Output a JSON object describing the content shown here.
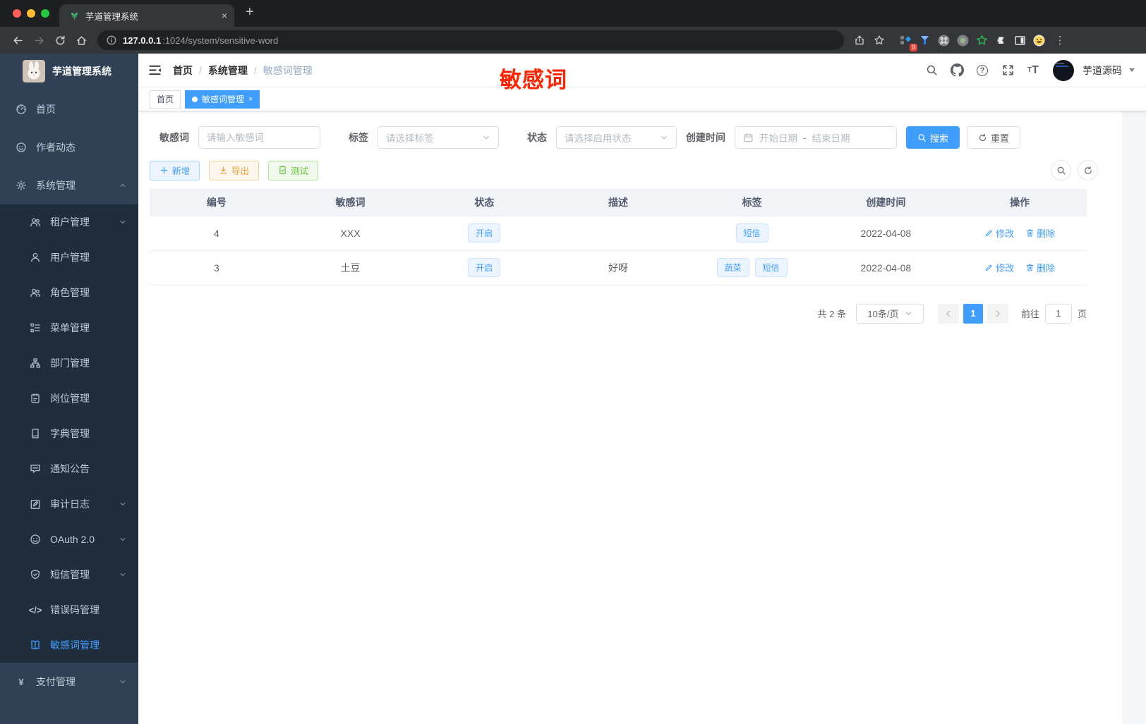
{
  "browser": {
    "tab_title": "芋道管理系统",
    "url_host": "127.0.0.1",
    "url_path": ":1024/system/sensitive-word",
    "extension_badge": "9"
  },
  "sidebar": {
    "title": "芋道管理系统",
    "items": [
      {
        "label": "首页",
        "icon": "dashboard-icon",
        "level": 1
      },
      {
        "label": "作者动态",
        "icon": "author-icon",
        "level": 1
      },
      {
        "label": "系统管理",
        "icon": "gear-icon",
        "level": 1,
        "chevron": "up"
      },
      {
        "label": "租户管理",
        "icon": "tenant-icon",
        "level": 2,
        "chevron": "down"
      },
      {
        "label": "用户管理",
        "icon": "user-icon",
        "level": 2
      },
      {
        "label": "角色管理",
        "icon": "role-icon",
        "level": 2
      },
      {
        "label": "菜单管理",
        "icon": "menu-tree-icon",
        "level": 2
      },
      {
        "label": "部门管理",
        "icon": "dept-icon",
        "level": 2
      },
      {
        "label": "岗位管理",
        "icon": "post-icon",
        "level": 2
      },
      {
        "label": "字典管理",
        "icon": "dict-icon",
        "level": 2
      },
      {
        "label": "通知公告",
        "icon": "notice-icon",
        "level": 2
      },
      {
        "label": "审计日志",
        "icon": "audit-icon",
        "level": 2,
        "chevron": "down"
      },
      {
        "label": "OAuth 2.0",
        "icon": "oauth-icon",
        "level": 2,
        "chevron": "down"
      },
      {
        "label": "短信管理",
        "icon": "sms-icon",
        "level": 2,
        "chevron": "down"
      },
      {
        "label": "错误码管理",
        "icon": "errorcode-icon",
        "level": 2
      },
      {
        "label": "敏感词管理",
        "icon": "sensitive-word-icon",
        "level": 2,
        "active": true
      },
      {
        "label": "支付管理",
        "icon": "pay-icon",
        "level": 1,
        "chevron": "down"
      }
    ]
  },
  "header": {
    "breadcrumb": [
      "首页",
      "系统管理",
      "敏感词管理"
    ],
    "user_name": "芋道源码"
  },
  "tags_view": {
    "tabs": [
      {
        "label": "首页",
        "active": false,
        "closable": false
      },
      {
        "label": "敏感词管理",
        "active": true,
        "closable": true
      }
    ]
  },
  "annotation": {
    "text": "敏感词",
    "color": "#ff2400"
  },
  "filters": {
    "word": {
      "label": "敏感词",
      "placeholder": "请输入敏感词"
    },
    "tag": {
      "label": "标签",
      "placeholder": "请选择标签"
    },
    "status": {
      "label": "状态",
      "placeholder": "请选择启用状态"
    },
    "create_time": {
      "label": "创建时间",
      "start_placeholder": "开始日期",
      "separator": "-",
      "end_placeholder": "结束日期"
    },
    "search_label": "搜索",
    "reset_label": "重置"
  },
  "toolbar": {
    "add_label": "新增",
    "export_label": "导出",
    "test_label": "测试"
  },
  "table": {
    "columns": [
      "编号",
      "敏感词",
      "状态",
      "描述",
      "标签",
      "创建时间",
      "操作"
    ],
    "rows": [
      {
        "id": "4",
        "word": "XXX",
        "status": "开启",
        "description": "",
        "tags": [
          "短信"
        ],
        "created_at": "2022-04-08"
      },
      {
        "id": "3",
        "word": "土豆",
        "status": "开启",
        "description": "好呀",
        "tags": [
          "蔬菜",
          "短信"
        ],
        "created_at": "2022-04-08"
      }
    ],
    "edit_label": "修改",
    "delete_label": "删除"
  },
  "pagination": {
    "total_text": "共 2 条",
    "page_size": "10条/页",
    "current_page": "1",
    "goto_label": "前往",
    "goto_value": "1",
    "page_unit": "页"
  },
  "colors": {
    "primary": "#409eff",
    "sidebar_bg": "#304156",
    "submenu_bg": "#1f2d3d",
    "annotation_red": "#ff2400"
  }
}
